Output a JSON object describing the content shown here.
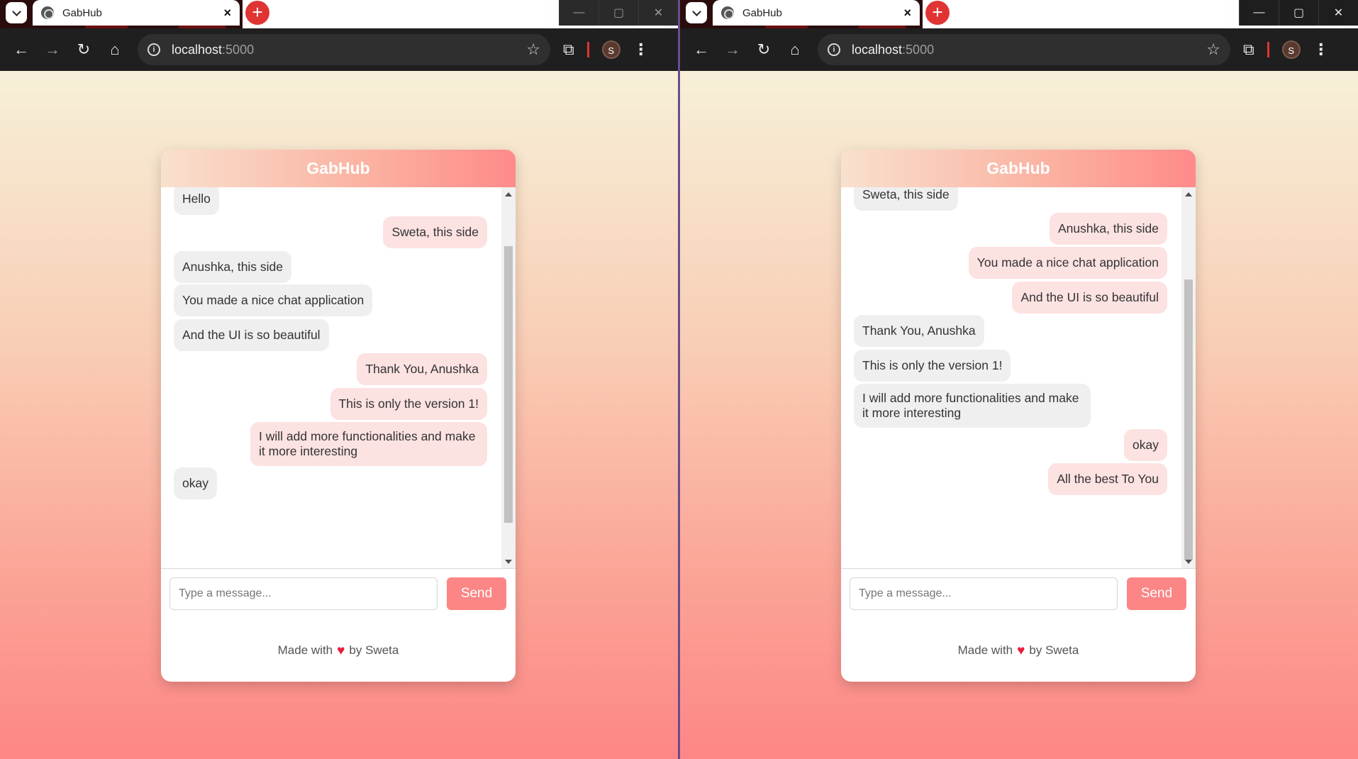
{
  "browser": {
    "tab_title": "GabHub",
    "tab_close": "×",
    "new_tab": "+",
    "url_host": "localhost",
    "url_port": ":5000",
    "profile_initial": "S",
    "window_controls": [
      "—",
      "▢",
      "✕"
    ]
  },
  "app": {
    "title": "GabHub",
    "input_placeholder": "Type a message...",
    "send_label": "Send",
    "footer_prefix": "Made with",
    "footer_heart": "♥",
    "footer_suffix": "by Sweta"
  },
  "left_messages": [
    {
      "text": "Hello",
      "side": "recv"
    },
    {
      "text": "Sweta, this side",
      "side": "sent"
    },
    {
      "text": "Anushka, this side",
      "side": "recv"
    },
    {
      "text": "You made a nice chat application",
      "side": "recv"
    },
    {
      "text": "And the UI is so beautiful",
      "side": "recv"
    },
    {
      "text": "Thank You, Anushka",
      "side": "sent"
    },
    {
      "text": "This is only the version 1!",
      "side": "sent"
    },
    {
      "text": "I will add more functionalities and make it more interesting",
      "side": "sent"
    },
    {
      "text": "okay",
      "side": "recv"
    }
  ],
  "right_messages": [
    {
      "text": "Sweta, this side",
      "side": "recv"
    },
    {
      "text": "Anushka, this side",
      "side": "sent"
    },
    {
      "text": "You made a nice chat application",
      "side": "sent"
    },
    {
      "text": "And the UI is so beautiful",
      "side": "sent"
    },
    {
      "text": "Thank You, Anushka",
      "side": "recv"
    },
    {
      "text": "This is only the version 1!",
      "side": "recv"
    },
    {
      "text": "I will add more functionalities and make it more interesting",
      "side": "recv"
    },
    {
      "text": "okay",
      "side": "sent"
    },
    {
      "text": "All the best To You",
      "side": "sent"
    }
  ]
}
